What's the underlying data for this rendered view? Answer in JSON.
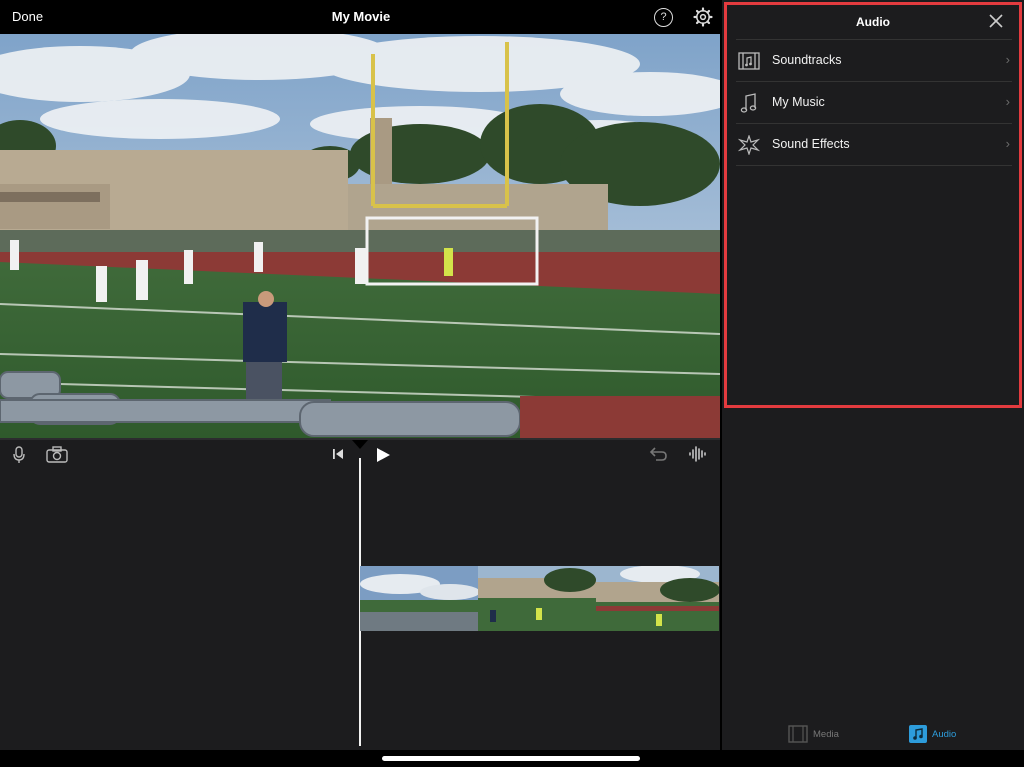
{
  "topbar": {
    "done_label": "Done",
    "title": "My Movie",
    "help_glyph": "?",
    "icons": [
      "help-icon",
      "gear-icon"
    ]
  },
  "timeline_toolbar": {
    "icons": [
      "microphone-icon",
      "camera-icon",
      "skip-to-start-icon",
      "play-icon",
      "undo-icon",
      "audio-waveform-icon"
    ]
  },
  "audio_panel": {
    "title": "Audio",
    "items": [
      {
        "label": "Soundtracks",
        "icon": "film-music-icon"
      },
      {
        "label": "My Music",
        "icon": "music-note-icon"
      },
      {
        "label": "Sound Effects",
        "icon": "burst-icon"
      }
    ],
    "chevron": "›",
    "highlight_color": "#e33b3f"
  },
  "bottom_tabs": {
    "media_label": "Media",
    "audio_label": "Audio",
    "active": "Audio",
    "accent_color": "#2d9cdb"
  }
}
